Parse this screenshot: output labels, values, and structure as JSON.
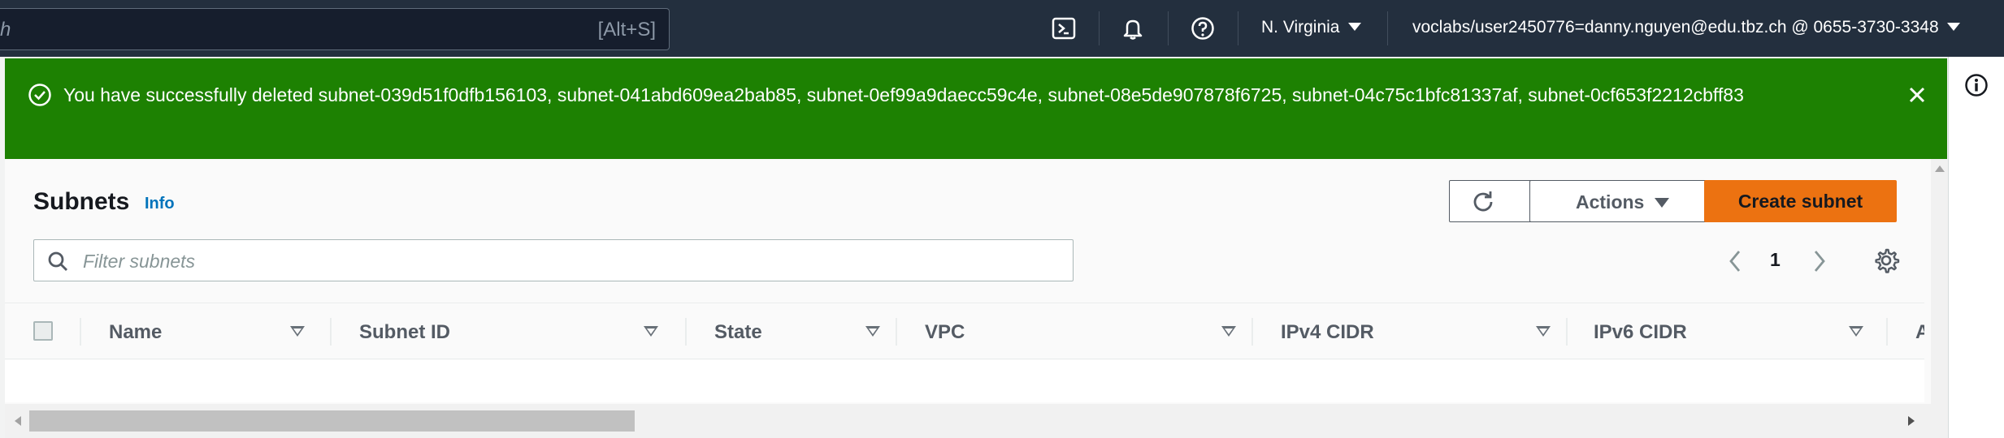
{
  "topnav": {
    "search_value": "h",
    "search_shortcut": "[Alt+S]",
    "region": "N. Virginia",
    "account": "voclabs/user2450776=danny.nguyen@edu.tbz.ch @ 0655-3730-3348",
    "icons": [
      "cloudshell-icon",
      "notifications-bell-icon",
      "help-icon"
    ]
  },
  "flash": {
    "type": "success",
    "color": "#1d8102",
    "message": "You have successfully deleted subnet-039d51f0dfb156103, subnet-041abd609ea2bab85, subnet-0ef99a9daecc59c4e, subnet-08e5de907878f6725, subnet-04c75c1bfc81337af, subnet-0cf653f2212cbff83"
  },
  "header": {
    "title": "Subnets",
    "info_link": "Info",
    "actions_label": "Actions",
    "create_label": "Create subnet",
    "create_color": "#ec7211"
  },
  "filter": {
    "placeholder": "Filter subnets",
    "value": ""
  },
  "pagination": {
    "current_page": "1"
  },
  "table": {
    "columns": [
      "Name",
      "Subnet ID",
      "State",
      "VPC",
      "IPv4 CIDR",
      "IPv6 CIDR",
      "A"
    ],
    "rows": []
  }
}
